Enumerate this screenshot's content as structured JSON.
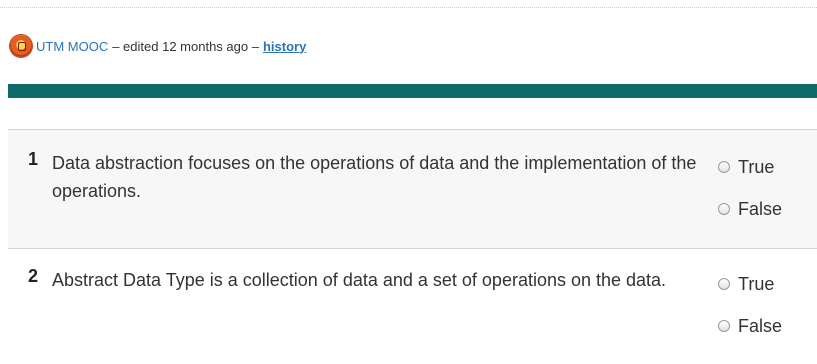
{
  "byline": {
    "author": "UTM MOOC",
    "edited_text": "– edited 12 months ago –",
    "history_label": "history"
  },
  "questions": [
    {
      "number": "1",
      "text": "Data abstraction focuses on the operations of data and the implementation of the operations.",
      "options": [
        "True",
        "False"
      ]
    },
    {
      "number": "2",
      "text": "Abstract Data Type is a collection of data and a set of operations on the data.",
      "options": [
        "True",
        "False"
      ]
    }
  ],
  "colors": {
    "accent_bar": "#0f6b6a",
    "link": "#2a73b8"
  }
}
